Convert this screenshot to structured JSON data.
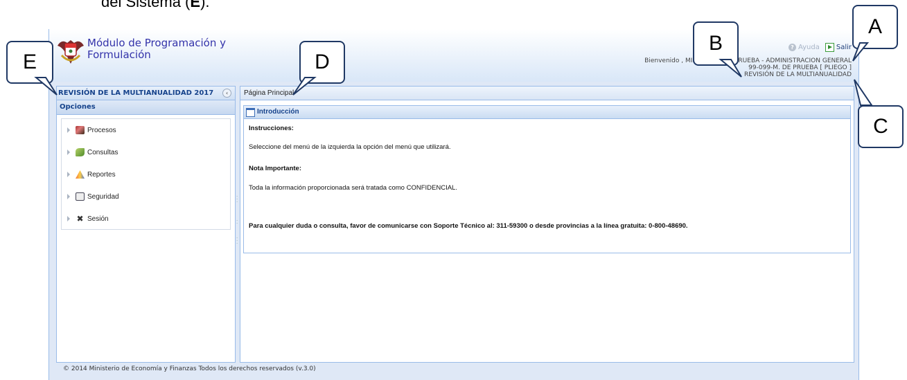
{
  "doc": {
    "caption": "del Sistema (",
    "letter": "E",
    "caption_end": ")."
  },
  "header": {
    "title_line1": "Módulo de Programación y",
    "title_line2": "Formulación",
    "help_label": "Ayuda",
    "exit_label": "Salir",
    "welcome": "Bienvenido , MINISTERIO DE PRUEBA - ADMINISTRACION GENERAL",
    "entity": "99-099-M. DE PRUEBA [ PLIEGO ]",
    "module": "REVISIÓN DE LA MULTIANUALIDAD"
  },
  "sidebar": {
    "title": "REVISIÓN DE LA MULTIANUALIDAD 2017",
    "options_label": "Opciones",
    "items": [
      {
        "label": "Procesos",
        "icon": "procesos-icon"
      },
      {
        "label": "Consultas",
        "icon": "consultas-icon"
      },
      {
        "label": "Reportes",
        "icon": "reportes-icon"
      },
      {
        "label": "Seguridad",
        "icon": "seguridad-icon"
      },
      {
        "label": "Sesión",
        "icon": "sesion-icon"
      }
    ]
  },
  "main": {
    "tab_label": "Página Principal",
    "intro": {
      "title": "Introducción",
      "instructions_heading": "Instrucciones:",
      "instructions_text": "Seleccione del menú de la izquierda la opción del menú que utilizará.",
      "note_heading": "Nota Importante:",
      "note_text": "Toda la información proporcionada será tratada como CONFIDENCIAL.",
      "support_text": "Para cualquier duda o consulta, favor de comunicarse con Soporte Técnico al: 311-59300 o desde provincias a la línea gratuita: 0-800-48690."
    }
  },
  "footer": {
    "copyright": "© 2014 Ministerio de Economía y Finanzas Todos los derechos reservados (v.3.0)"
  },
  "callouts": {
    "a": "A",
    "b": "B",
    "c": "C",
    "d": "D",
    "e": "E"
  }
}
